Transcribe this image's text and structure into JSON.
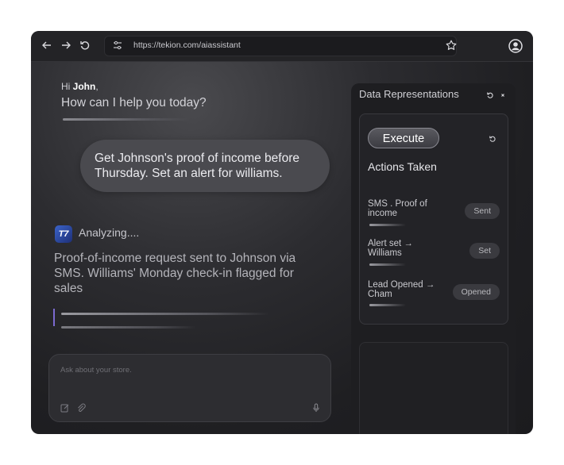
{
  "browser": {
    "back_icon": "arrow-left-icon",
    "forward_icon": "arrow-right-icon",
    "reload_icon": "reload-icon",
    "url": "https://tekion.com/aiassistant"
  },
  "chat": {
    "greeting_prefix": "Hi ",
    "greeting_name": "John",
    "greeting_suffix": ",",
    "question": "How can I help you today?",
    "user_message": "Get Johnson's proof of income before Thursday. Set an alert for williams.",
    "logo_text": "T7",
    "status": "Analyzing....",
    "response": "Proof-of-income request sent to Johnson via SMS. Williams' Monday check-in flagged for sales",
    "input_placeholder": "Ask about your store."
  },
  "panel": {
    "title": "Data Representations",
    "execute_label": "Execute",
    "actions_title": "Actions Taken",
    "actions": [
      {
        "label": "SMS . Proof of income",
        "status": "Sent"
      },
      {
        "label": "Alert set → Williams",
        "status": "Set"
      },
      {
        "label": "Lead Opened → Cham",
        "status": "Opened"
      }
    ]
  },
  "colors": {
    "background": "#1f1f22",
    "bubble": "#4a4a4f",
    "accent_caret": "#7c6ad0",
    "logo": "#3b63c9"
  }
}
